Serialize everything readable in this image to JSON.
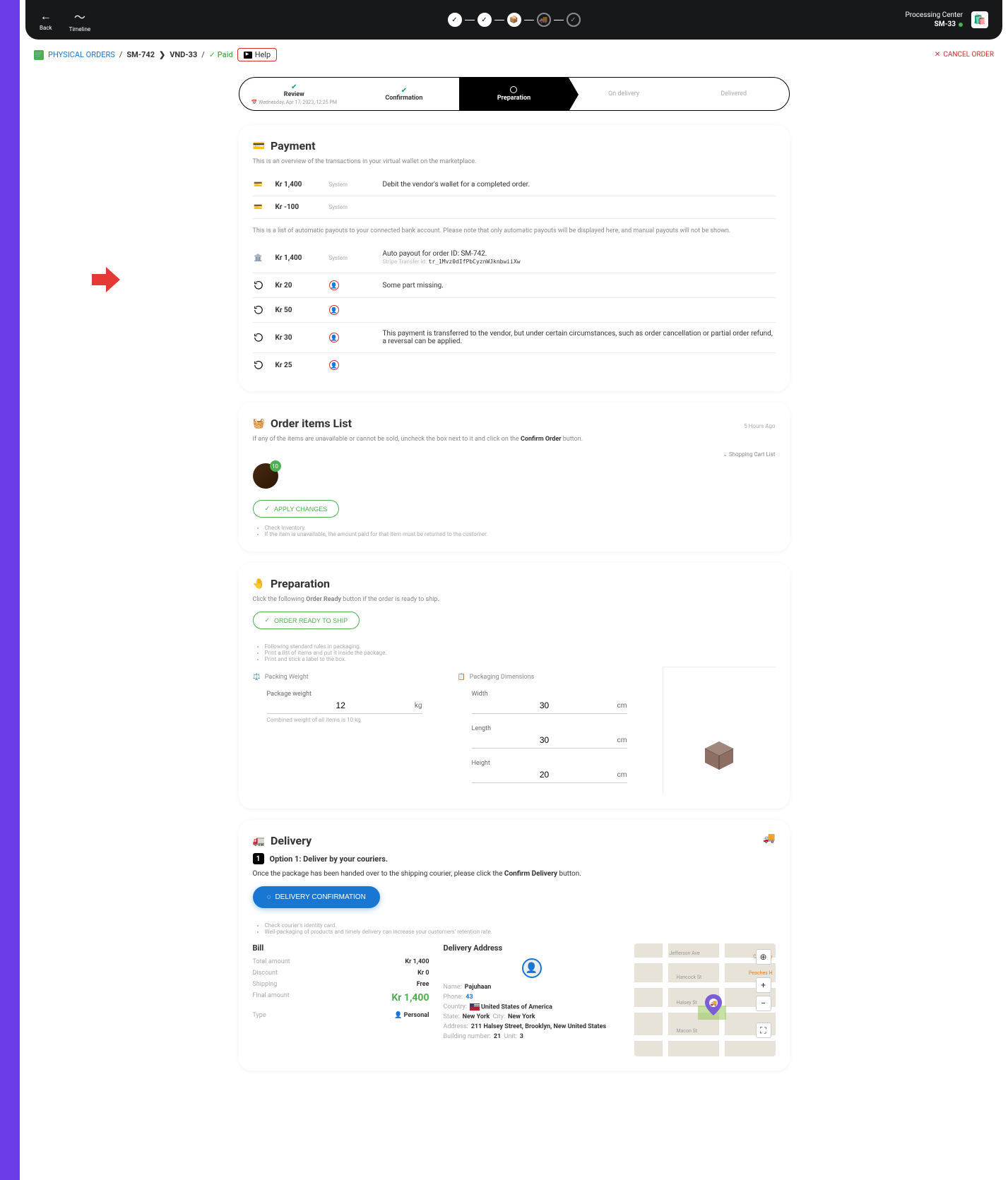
{
  "topbar": {
    "back": "Back",
    "timeline": "Timeline",
    "pc_title": "Processing Center",
    "pc_code": "SM-33"
  },
  "breadcrumb": {
    "physical_orders": "PHYSICAL ORDERS",
    "order_id": "SM-742",
    "vendor": "VND-33",
    "paid": "Paid",
    "help": "Help",
    "cancel": "CANCEL ORDER"
  },
  "stepper": {
    "review": "Review",
    "review_date": "Wednesday, Apr 17, 2023, 12:25 PM",
    "confirmation": "Confirmation",
    "preparation": "Preparation",
    "on_delivery": "On delivery",
    "delivered": "Delivered"
  },
  "payment": {
    "title": "Payment",
    "sub": "This is an overview of the transactions in your virtual wallet on the marketplace.",
    "note": "This is a list of automatic payouts to your connected bank account. Please note that only automatic payouts will be displayed here, and manual payouts will not be shown.",
    "rows": [
      {
        "amount": "Kr 1,400",
        "badge": "System",
        "desc": "Debit the vendor's wallet for a completed order."
      },
      {
        "amount": "Kr -100",
        "badge": "System",
        "desc": ""
      }
    ],
    "payout_rows": [
      {
        "amount": "Kr 1,400",
        "badge": "System",
        "desc": "Auto payout for order ID: SM-742.",
        "sub_label": "Stripe Transfer id:",
        "sub_code": "tr_1Mvz0dIfPbCyznWJknbwiiXw"
      },
      {
        "amount": "Kr 20",
        "badge": "user",
        "desc": "Some part missing."
      },
      {
        "amount": "Kr 50",
        "badge": "user",
        "desc": ""
      },
      {
        "amount": "Kr 30",
        "badge": "user",
        "desc": "This payment is transferred to the vendor, but under certain circumstances, such as order cancellation or partial order refund, a reversal can be applied."
      },
      {
        "amount": "Kr 25",
        "badge": "user",
        "desc": ""
      }
    ]
  },
  "order_items": {
    "title": "Order items List",
    "hours_ago": "5 Hours Ago",
    "sub_pre": "If any of the items are unavailable or cannot be sold, uncheck the box next to it and click on the ",
    "sub_bold": "Confirm Order",
    "sub_post": " button.",
    "cart_link": "Shopping Cart List",
    "item_qty": "10",
    "apply": "APPLY CHANGES",
    "tip1": "Check inventory.",
    "tip2": "If the item is unavailable, the amount paid for that item must be returned to the customer."
  },
  "preparation": {
    "title": "Preparation",
    "sub_pre": "Click the following ",
    "sub_bold": "Order Ready",
    "sub_post": " button if the order is ready to ship.",
    "ready_btn": "ORDER READY TO SHIP",
    "tip1": "Following standard rules in packaging.",
    "tip2": "Print a list of items and put it inside the package.",
    "tip3": "Print and stick a label to the box.",
    "packing_weight_label": "Packing Weight",
    "packaging_dims_label": "Packaging Dimensions",
    "weight_label": "Package weight",
    "weight_val": "12",
    "weight_unit": "kg",
    "weight_hint": "Combined weight of all items is 10 kg",
    "width_label": "Width",
    "width_val": "30",
    "width_unit": "cm",
    "length_label": "Length",
    "length_val": "30",
    "length_unit": "cm",
    "height_label": "Height",
    "height_val": "20",
    "height_unit": "cm"
  },
  "delivery": {
    "title": "Delivery",
    "option1": "Option 1: Deliver by your couriers.",
    "sub_pre": "Once the package has been handed over to the shipping courier, please click the ",
    "sub_bold": "Confirm Delivery",
    "sub_post": " button.",
    "confirm_btn": "DELIVERY CONFIRMATION",
    "tip1": "Check courier's identity card.",
    "tip2": "Well-packaging of products and timely delivery can increase your customers' retention rate.",
    "bill": {
      "title": "Bill",
      "total_label": "Total amount",
      "total_val": "Kr 1,400",
      "discount_label": "Discount",
      "discount_val": "Kr 0",
      "shipping_label": "Shipping",
      "shipping_val": "Free",
      "final_label": "Final amount",
      "final_val": "Kr 1,400",
      "type_label": "Type",
      "type_val": "Personal"
    },
    "address": {
      "title": "Delivery Address",
      "name_k": "Name:",
      "name_v": "Pajuhaan",
      "phone_k": "Phone:",
      "phone_v": "43",
      "country_k": "Country:",
      "country_v": "United States of America",
      "state_k": "State:",
      "state_v": "New York",
      "city_k": "City:",
      "city_v": "New York",
      "addr_k": "Address:",
      "addr_v": "211 Halsey Street, Brooklyn, New United States",
      "building_k": "Building number:",
      "building_v": "21",
      "unit_k": "Unit:",
      "unit_v": "3"
    },
    "map": {
      "jefferson": "Jefferson Ave",
      "hancock": "Hancock St",
      "halsey": "Halsey St",
      "macon": "Macon St",
      "oddly": "Oddly En",
      "peaches": "Peaches H"
    }
  }
}
